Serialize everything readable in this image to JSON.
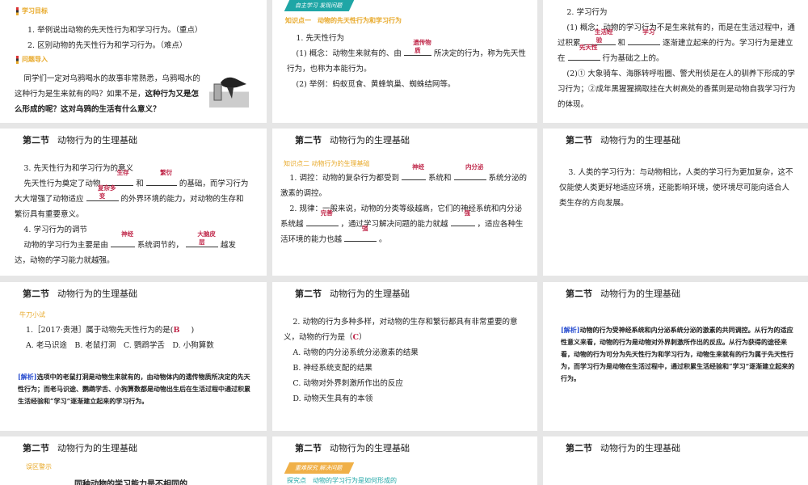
{
  "section_title": {
    "num": "第二节",
    "name": "动物行为的生理基础"
  },
  "s1": {
    "tag1": "学习目标",
    "goal1": "1. 举例说出动物的先天性行为和学习行为。（重点）",
    "goal2": "2. 区别动物的先天性行为和学习行为。（难点）",
    "tag2": "问题导入",
    "p1": "同学们一定对乌鸦喝水的故事非常熟悉，乌鸦喝水的这种行为是生来就有的吗？如果不是，",
    "p1b": "这种行为又是怎么形成的呢？这对乌鸦的生活有什么意义？"
  },
  "s2": {
    "banner": "自主学习 发现问题",
    "tag": "知识点一　动物的先天性行为和学习行为",
    "h": "1. 先天性行为",
    "a": "(1) 概念：动物生来就有的、由",
    "a_ans": "遗传物质",
    "a2": "所决定的行为，称为先天性行为，也称为本能行为。",
    "b": "(2) 举例：蚂蚁觅食、黄蜂筑巢、蜘蛛结网等。"
  },
  "s3": {
    "h": "2. 学习行为",
    "a": "(1) 概念：动物的学习行为不是生来就有的，而是在生活过程中，通过积累",
    "ans1": "生活经验",
    "and": "和",
    "ans2": "学习",
    "a2": "逐渐建立起来的行为。学习行为是建立在",
    "ans3": "先天性",
    "a3": "行为基础之上的。",
    "b": "(2)① 大象骑车、海豚转呼啦圈、警犬刑侦是在人的驯养下形成的学习行为；②成年黑猩猩摘取挂在大树高处的香蕉则是动物自我学习行为的体现。"
  },
  "s4": {
    "h3": "3. 先天性行为和学习行为的意义",
    "p1": "先天性行为奠定了动物",
    "ans1": "生存",
    "and": "和",
    "ans2": "繁衍",
    "p2": "的基础，而学习行为大大增强了动物适应",
    "ans3": "复杂多变",
    "p3": "的外界环境的能力，对动物的生存和繁衍具有重要意义。",
    "h4": "4. 学习行为的调节",
    "q1": "动物的学习行为主要是由",
    "ans4": "神经",
    "q2": "系统调节的，",
    "ans5": "大脑皮层",
    "q3": "越发达，动物的学习能力就越强。"
  },
  "s5": {
    "tag": "知识点二 动物行为的生理基础",
    "p1": "1. 调控：动物的复杂行为都受到",
    "ans1": "神经",
    "p2": "系统和",
    "ans2": "内分泌",
    "p3": "系统分泌的激素的调控。",
    "q1": "2. 规律：一般来说，动物的分类等级越高，它们的神经系统和内分泌系统越",
    "ans3": "完善",
    "q2": "，通过学习解决问题的能力就越",
    "ans4": "强",
    "q3": "，适应各种生活环境的能力也越",
    "ans5": "强",
    "q4": "。"
  },
  "s6": {
    "p": "3. 人类的学习行为：与动物相比，人类的学习行为更加复杂，这不仅能使人类更好地适应环境，还能影响环境，使环境尽可能向适合人类生存的方向发展。"
  },
  "s7": {
    "tag": "牛刀小试",
    "q": "1.［2017·贵港］属于动物先天性行为的是(",
    "ans": "B",
    "q_end": ")",
    "opts": "A. 老马识途　B. 老鼠打洞　C. 鹦鹉学舌　D. 小狗算数",
    "jx_label": "[解析]",
    "jx": "选项中的老鼠打洞是动物生来就有的，由动物体内的遗传物质所决定的先天性行为；而老马识途、鹦鹉学舌、小狗算数都是动物出生后在生活过程中通过积累生活经验和“学习”逐渐建立起来的学习行为。"
  },
  "s8": {
    "q": "2. 动物的行为多种多样，对动物的生存和繁衍都具有非常重要的意义，动物的行为是（",
    "ans": "C",
    "q_end": "）",
    "opts": [
      "A. 动物的内分泌系统分泌激素的结果",
      "B. 神经系统支配的结果",
      "C. 动物对外界刺激所作出的反应",
      "D. 动物天生具有的本领"
    ]
  },
  "s9": {
    "jx_label": "[解析]",
    "jx": "动物的行为受神经系统和内分泌系统分泌的激素的共同调控。从行为的适应性意义来看，动物的行为是动物对外界刺激所作出的反应。从行为获得的途径来看，动物的行为可分为先天性行为和学习行为，动物生来就有的行为属于先天性行为，而学习行为是动物在生活过程中，通过积累生活经验和“学习”逐渐建立起来的行为。"
  },
  "s10": {
    "tag": "误区警示",
    "h": "同种动物的学习能力是不相同的"
  },
  "s11": {
    "banner": "重难探究 解决问题",
    "tag": "探究点　动物的学习行为是如何形成的"
  }
}
